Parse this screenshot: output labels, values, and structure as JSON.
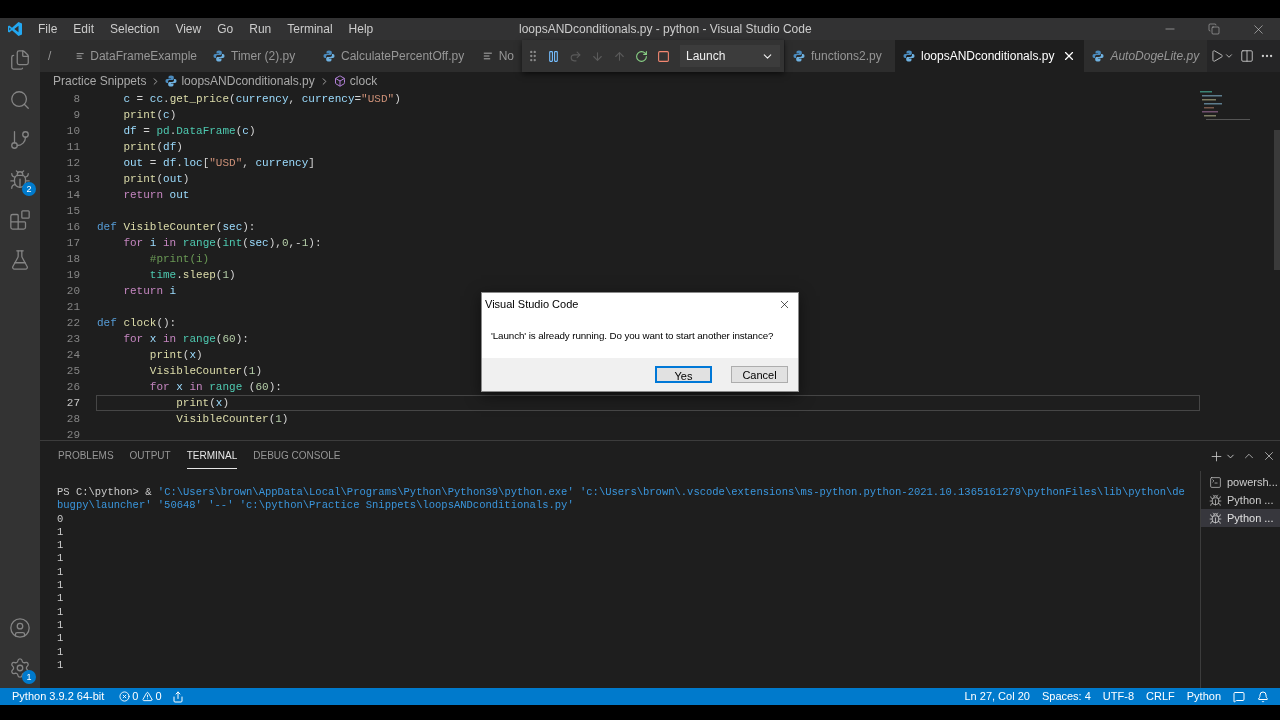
{
  "window": {
    "title": "loopsANDconditionals.py - python - Visual Studio Code"
  },
  "menu": [
    "File",
    "Edit",
    "Selection",
    "View",
    "Go",
    "Run",
    "Terminal",
    "Help"
  ],
  "activity_bar": {
    "top": [
      {
        "kind": "files"
      },
      {
        "kind": "search"
      },
      {
        "kind": "source-control"
      },
      {
        "kind": "debug",
        "badge": "2"
      },
      {
        "kind": "extensions"
      },
      {
        "kind": "testing"
      }
    ],
    "bottom": [
      {
        "kind": "account"
      },
      {
        "kind": "settings",
        "badge": "1"
      }
    ]
  },
  "tabs": [
    {
      "label": "/",
      "kind": "plain",
      "selected": false,
      "preview": false
    },
    {
      "label": "DataFrameExample",
      "kind": "text",
      "selected": false,
      "preview": false
    },
    {
      "label": "Timer (2).py",
      "kind": "python",
      "selected": false,
      "preview": false
    },
    {
      "label": "CalculatePercentOff.py",
      "kind": "python",
      "selected": false,
      "preview": false
    },
    {
      "label": "No",
      "kind": "text",
      "selected": false,
      "preview": false
    },
    {
      "label": "functions2.py",
      "kind": "python",
      "selected": false,
      "preview": false
    },
    {
      "label": "loopsANDconditionals.py",
      "kind": "python",
      "selected": true,
      "preview": false
    },
    {
      "label": "AutoDogeLite.py",
      "kind": "python",
      "selected": false,
      "preview": true
    }
  ],
  "debug_toolbar": {
    "buttons": [
      {
        "kind": "pause",
        "disabled": false
      },
      {
        "kind": "step-over",
        "disabled": true
      },
      {
        "kind": "step-into",
        "disabled": true
      },
      {
        "kind": "step-out",
        "disabled": true
      },
      {
        "kind": "restart",
        "disabled": false
      },
      {
        "kind": "stop",
        "disabled": false
      }
    ],
    "configuration": "Launch"
  },
  "breadcrumb": [
    "Practice Snippets",
    "loopsANDconditionals.py",
    "clock"
  ],
  "editor": {
    "lines": [
      {
        "number": "8",
        "current": false,
        "tokens": [
          {
            "kind": "var",
            "text": "    c"
          },
          {
            "kind": "plain",
            "text": " = "
          },
          {
            "kind": "var",
            "text": "cc"
          },
          {
            "kind": "plain",
            "text": "."
          },
          {
            "kind": "func",
            "text": "get_price"
          },
          {
            "kind": "plain",
            "text": "("
          },
          {
            "kind": "var",
            "text": "currency"
          },
          {
            "kind": "plain",
            "text": ", "
          },
          {
            "kind": "var",
            "text": "currency"
          },
          {
            "kind": "plain",
            "text": "="
          },
          {
            "kind": "string",
            "text": "\"USD\""
          },
          {
            "kind": "plain",
            "text": ")"
          }
        ]
      },
      {
        "number": "9",
        "current": false,
        "tokens": [
          {
            "kind": "func",
            "text": "    print"
          },
          {
            "kind": "plain",
            "text": "("
          },
          {
            "kind": "var",
            "text": "c"
          },
          {
            "kind": "plain",
            "text": ")"
          }
        ]
      },
      {
        "number": "10",
        "current": false,
        "tokens": [
          {
            "kind": "var",
            "text": "    df"
          },
          {
            "kind": "plain",
            "text": " = "
          },
          {
            "kind": "class",
            "text": "pd"
          },
          {
            "kind": "plain",
            "text": "."
          },
          {
            "kind": "class",
            "text": "DataFrame"
          },
          {
            "kind": "plain",
            "text": "("
          },
          {
            "kind": "var",
            "text": "c"
          },
          {
            "kind": "plain",
            "text": ")"
          }
        ]
      },
      {
        "number": "11",
        "current": false,
        "tokens": [
          {
            "kind": "func",
            "text": "    print"
          },
          {
            "kind": "plain",
            "text": "("
          },
          {
            "kind": "var",
            "text": "df"
          },
          {
            "kind": "plain",
            "text": ")"
          }
        ]
      },
      {
        "number": "12",
        "current": false,
        "tokens": [
          {
            "kind": "var",
            "text": "    out"
          },
          {
            "kind": "plain",
            "text": " = "
          },
          {
            "kind": "var",
            "text": "df"
          },
          {
            "kind": "plain",
            "text": "."
          },
          {
            "kind": "var",
            "text": "loc"
          },
          {
            "kind": "plain",
            "text": "["
          },
          {
            "kind": "string",
            "text": "\"USD\""
          },
          {
            "kind": "plain",
            "text": ", "
          },
          {
            "kind": "var",
            "text": "currency"
          },
          {
            "kind": "plain",
            "text": "]"
          }
        ]
      },
      {
        "number": "13",
        "current": false,
        "tokens": [
          {
            "kind": "func",
            "text": "    print"
          },
          {
            "kind": "plain",
            "text": "("
          },
          {
            "kind": "var",
            "text": "out"
          },
          {
            "kind": "plain",
            "text": ")"
          }
        ]
      },
      {
        "number": "14",
        "current": false,
        "tokens": [
          {
            "kind": "keyword",
            "text": "    return"
          },
          {
            "kind": "var",
            "text": " out"
          }
        ]
      },
      {
        "number": "15",
        "current": false
      },
      {
        "number": "16",
        "current": false,
        "tokens": [
          {
            "kind": "def",
            "text": "def"
          },
          {
            "kind": "func",
            "text": " VisibleCounter"
          },
          {
            "kind": "plain",
            "text": "("
          },
          {
            "kind": "var",
            "text": "sec"
          },
          {
            "kind": "plain",
            "text": "):"
          }
        ]
      },
      {
        "number": "17",
        "current": false,
        "tokens": [
          {
            "kind": "keyword",
            "text": "    for"
          },
          {
            "kind": "var",
            "text": " i"
          },
          {
            "kind": "keyword",
            "text": " in"
          },
          {
            "kind": "class",
            "text": " range"
          },
          {
            "kind": "plain",
            "text": "("
          },
          {
            "kind": "class",
            "text": "int"
          },
          {
            "kind": "plain",
            "text": "("
          },
          {
            "kind": "var",
            "text": "sec"
          },
          {
            "kind": "plain",
            "text": "),"
          },
          {
            "kind": "number",
            "text": "0"
          },
          {
            "kind": "plain",
            "text": ",-"
          },
          {
            "kind": "number",
            "text": "1"
          },
          {
            "kind": "plain",
            "text": "):"
          }
        ]
      },
      {
        "number": "18",
        "current": false,
        "tokens": [
          {
            "kind": "comment",
            "text": "        #print(i)"
          }
        ]
      },
      {
        "number": "19",
        "current": false,
        "tokens": [
          {
            "kind": "class",
            "text": "        time"
          },
          {
            "kind": "plain",
            "text": "."
          },
          {
            "kind": "func",
            "text": "sleep"
          },
          {
            "kind": "plain",
            "text": "("
          },
          {
            "kind": "number",
            "text": "1"
          },
          {
            "kind": "plain",
            "text": ")"
          }
        ]
      },
      {
        "number": "20",
        "current": false,
        "tokens": [
          {
            "kind": "keyword",
            "text": "    return"
          },
          {
            "kind": "var",
            "text": " i"
          }
        ]
      },
      {
        "number": "21",
        "current": false
      },
      {
        "number": "22",
        "current": false,
        "tokens": [
          {
            "kind": "def",
            "text": "def"
          },
          {
            "kind": "func",
            "text": " clock"
          },
          {
            "kind": "plain",
            "text": "():"
          }
        ]
      },
      {
        "number": "23",
        "current": false,
        "tokens": [
          {
            "kind": "keyword",
            "text": "    for"
          },
          {
            "kind": "var",
            "text": " x"
          },
          {
            "kind": "keyword",
            "text": " in"
          },
          {
            "kind": "class",
            "text": " range"
          },
          {
            "kind": "plain",
            "text": "("
          },
          {
            "kind": "number",
            "text": "60"
          },
          {
            "kind": "plain",
            "text": "):"
          }
        ]
      },
      {
        "number": "24",
        "current": false,
        "tokens": [
          {
            "kind": "func",
            "text": "        print"
          },
          {
            "kind": "plain",
            "text": "("
          },
          {
            "kind": "var",
            "text": "x"
          },
          {
            "kind": "plain",
            "text": ")"
          }
        ]
      },
      {
        "number": "25",
        "current": false,
        "tokens": [
          {
            "kind": "func",
            "text": "        VisibleCounter"
          },
          {
            "kind": "plain",
            "text": "("
          },
          {
            "kind": "number",
            "text": "1"
          },
          {
            "kind": "plain",
            "text": ")"
          }
        ]
      },
      {
        "number": "26",
        "current": false,
        "tokens": [
          {
            "kind": "keyword",
            "text": "        for"
          },
          {
            "kind": "var",
            "text": " x"
          },
          {
            "kind": "keyword",
            "text": " in"
          },
          {
            "kind": "class",
            "text": " range"
          },
          {
            "kind": "plain",
            "text": " ("
          },
          {
            "kind": "number",
            "text": "60"
          },
          {
            "kind": "plain",
            "text": "):"
          }
        ]
      },
      {
        "number": "27",
        "current": true,
        "tokens": [
          {
            "kind": "func",
            "text": "            print"
          },
          {
            "kind": "plain",
            "text": "("
          },
          {
            "kind": "var",
            "text": "x"
          },
          {
            "kind": "plain",
            "text": ")"
          }
        ]
      },
      {
        "number": "28",
        "current": false,
        "tokens": [
          {
            "kind": "func",
            "text": "            VisibleCounter"
          },
          {
            "kind": "plain",
            "text": "("
          },
          {
            "kind": "number",
            "text": "1"
          },
          {
            "kind": "plain",
            "text": ")"
          }
        ]
      },
      {
        "number": "29",
        "current": false
      }
    ]
  },
  "panel": {
    "tabs": [
      {
        "label": "PROBLEMS",
        "selected": false
      },
      {
        "label": "OUTPUT",
        "selected": false
      },
      {
        "label": "TERMINAL",
        "selected": true
      },
      {
        "label": "DEBUG CONSOLE",
        "selected": false
      }
    ],
    "terminal": {
      "prompt": "PS C:\\python>  & ",
      "command": "'C:\\Users\\brown\\AppData\\Local\\Programs\\Python\\Python39\\python.exe' 'c:\\Users\\brown\\.vscode\\extensions\\ms-python.python-2021.10.1365161279\\pythonFiles\\lib\\python\\debugpy\\launcher' '50648' '--' 'c:\\python\\Practice Snippets\\loopsANDconditionals.py'",
      "output": [
        "0",
        "1",
        "1",
        "1",
        "1",
        "1",
        "1",
        "1",
        "1",
        "1",
        "1",
        "1"
      ]
    },
    "terminals": [
      {
        "label": "powersh...",
        "kind": "shell",
        "selected": false
      },
      {
        "label": "Python ...",
        "kind": "debug",
        "selected": false
      },
      {
        "label": "Python ...",
        "kind": "debug",
        "selected": true
      }
    ]
  },
  "dialog": {
    "title": "Visual Studio Code",
    "message": "'Launch' is already running. Do you want to start another instance?",
    "buttons": [
      {
        "label": "Yes",
        "default": true
      },
      {
        "label": "Cancel",
        "default": false
      }
    ]
  },
  "status_bar": {
    "left": [
      {
        "kind": "interpreter",
        "text": "Python 3.9.2 64-bit"
      },
      {
        "kind": "problems",
        "errors": "0",
        "warnings": "0"
      },
      {
        "kind": "live-share"
      }
    ],
    "right": [
      {
        "kind": "text",
        "text": "Ln 27, Col 20"
      },
      {
        "kind": "text",
        "text": "Spaces: 4"
      },
      {
        "kind": "text",
        "text": "UTF-8"
      },
      {
        "kind": "text",
        "text": "CRLF"
      },
      {
        "kind": "text",
        "text": "Python"
      },
      {
        "kind": "feedback"
      },
      {
        "kind": "notifications"
      }
    ]
  }
}
